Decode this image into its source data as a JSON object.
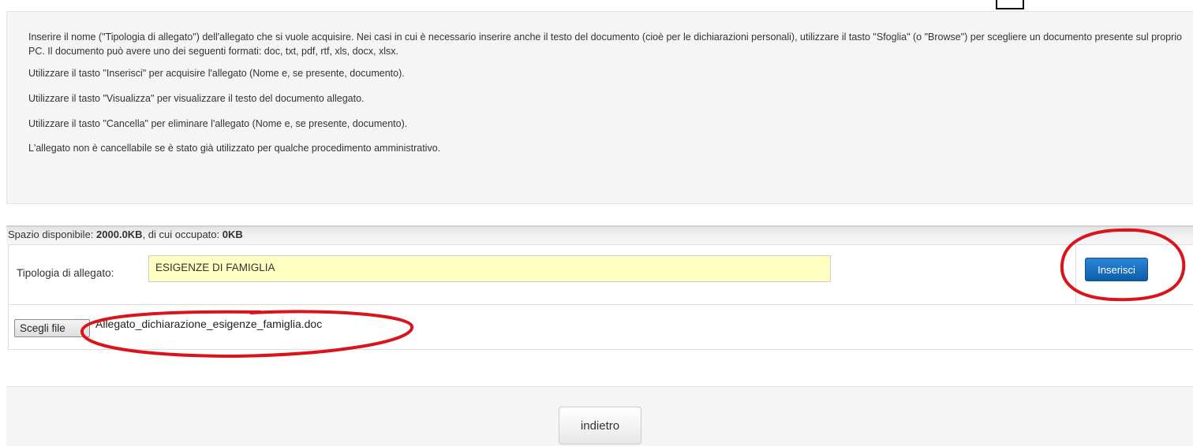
{
  "instructions": {
    "paragraph1": "Inserire il nome (\"Tipologia di allegato\") dell'allegato che si vuole acquisire. Nei casi in cui è necessario inserire anche il testo del documento (cioè per le dichiarazioni personali), utilizzare il tasto \"Sfoglia\" (o \"Browse\") per scegliere un documento presente sul proprio PC. Il documento può avere uno dei seguenti formati: doc, txt, pdf, rtf, xls, docx, xlsx.",
    "paragraph2": "Utilizzare il tasto \"Inserisci\" per acquisire l'allegato (Nome e, se presente, documento).",
    "paragraph3": "Utilizzare il tasto \"Visualizza\" per visualizzare il testo del documento allegato.",
    "paragraph4": "Utilizzare il tasto \"Cancella\" per eliminare l'allegato (Nome e, se presente, documento).",
    "paragraph5": "L'allegato non è cancellabile se è stato già utilizzato per qualche procedimento amministrativo."
  },
  "space": {
    "prefix": "Spazio disponibile: ",
    "available": "2000.0KB",
    "middle": ", di cui occupato: ",
    "occupied": "0KB"
  },
  "form": {
    "tipologia_label": "Tipologia di allegato:",
    "tipologia_value": "ESIGENZE DI FAMIGLIA",
    "inserisci_label": "Inserisci",
    "file_button_label": "Scegli file",
    "file_name": "Allegato_dichiarazione_esigenze_famiglia.doc"
  },
  "footer": {
    "back_label": "indietro"
  },
  "colors": {
    "annotation_red": "#d9141a",
    "primary_button": "#1565b7",
    "input_highlight": "#ffffc2"
  }
}
